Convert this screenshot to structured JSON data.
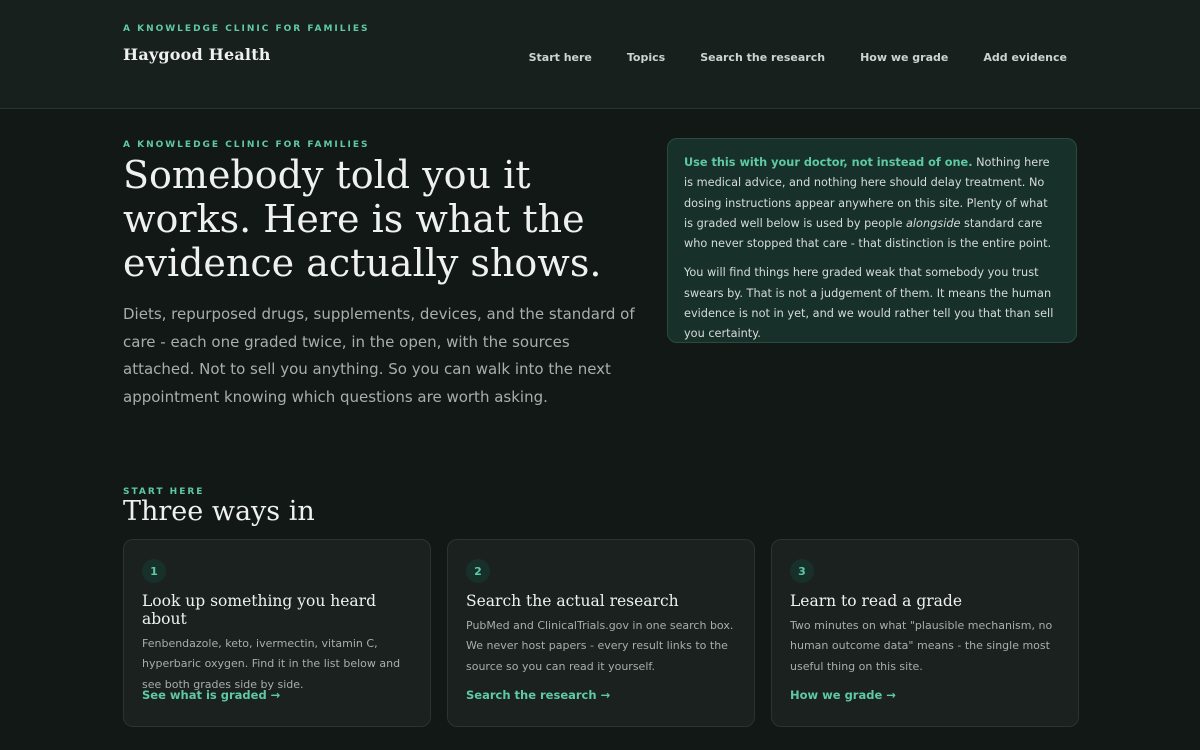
{
  "header": {
    "eyebrow": "A KNOWLEDGE CLINIC FOR FAMILIES",
    "brand": "Haygood Health",
    "nav": [
      "Start here",
      "Topics",
      "Search the research",
      "How we grade",
      "Add evidence"
    ]
  },
  "hero": {
    "eyebrow": "A KNOWLEDGE CLINIC FOR FAMILIES",
    "title": "Somebody told you it works. Here is what the evidence actually shows.",
    "subtitle": "Diets, repurposed drugs, supplements, devices, and the standard of care - each one graded twice, in the open, with the sources attached. Not to sell you anything. So you can walk into the next appointment knowing which questions are worth asking."
  },
  "notice": {
    "lead": "Use this with your doctor, not instead of one.",
    "p1_rest_a": " Nothing here is medical advice, and nothing here should delay treatment. No dosing instructions appear anywhere on this site. Plenty of what is graded well below is used by people ",
    "p1_em": "alongside",
    "p1_rest_b": " standard care who never stopped that care - that distinction is the entire point.",
    "p2": "You will find things here graded weak that somebody you trust swears by. That is not a judgement of them. It means the human evidence is not in yet, and we would rather tell you that than sell you certainty."
  },
  "section": {
    "eyebrow": "START HERE",
    "title": "Three ways in"
  },
  "cards": [
    {
      "num": "1",
      "title": "Look up something you heard about",
      "body": "Fenbendazole, keto, ivermectin, vitamin C, hyperbaric oxygen. Find it in the list below and see both grades side by side.",
      "link": "See what is graded →"
    },
    {
      "num": "2",
      "title": "Search the actual research",
      "body": "PubMed and ClinicalTrials.gov in one search box. We never host papers - every result links to the source so you can read it yourself.",
      "link": "Search the research →"
    },
    {
      "num": "3",
      "title": "Learn to read a grade",
      "body": "Two minutes on what \"plausible mechanism, no human outcome data\" means - the single most useful thing on this site.",
      "link": "How we grade →"
    }
  ],
  "colors": {
    "accent": "#5ec9a3",
    "background": "#121815",
    "notice_bg": "#173029"
  }
}
